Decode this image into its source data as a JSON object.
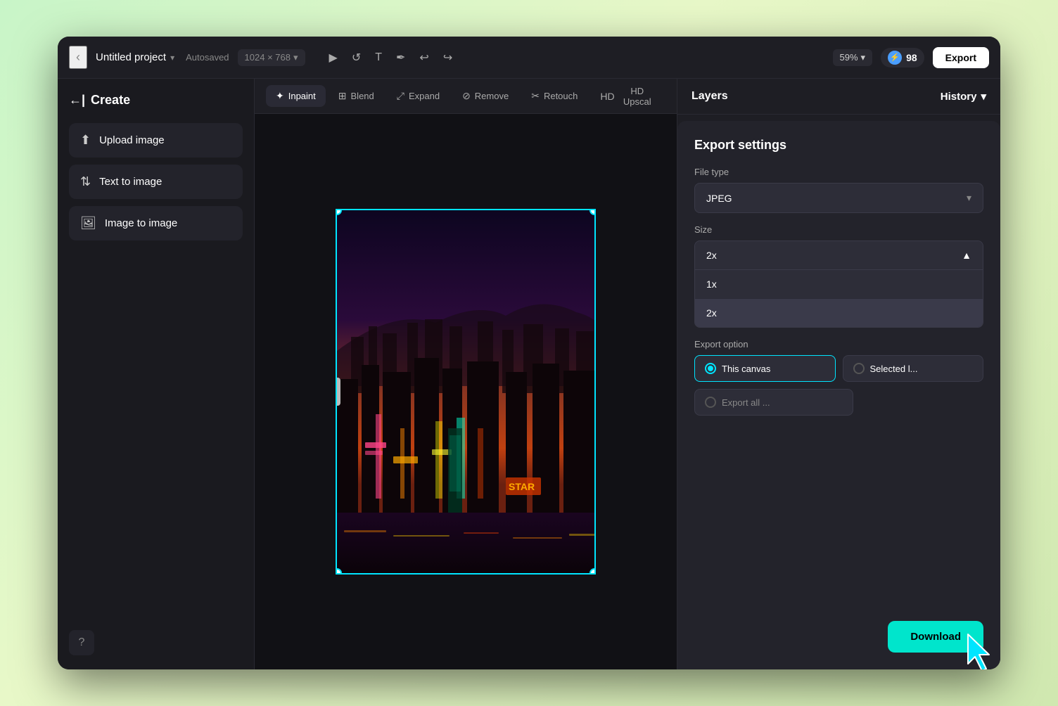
{
  "window": {
    "title": "Untitled project",
    "autosaved": "Autosaved",
    "dimensions": "1024 × 768",
    "zoom": "59%",
    "credits": "98",
    "export_btn": "Export"
  },
  "tools": {
    "select": "▶",
    "rotate": "↺",
    "text": "T",
    "pen": "✒",
    "undo": "↩",
    "redo": "↪"
  },
  "sidebar": {
    "title": "Create",
    "back_icon": "←|",
    "buttons": [
      {
        "label": "Upload image",
        "icon": "⬆"
      },
      {
        "label": "Text to image",
        "icon": "⇅"
      },
      {
        "label": "Image to image",
        "icon": "🖼"
      }
    ],
    "help": "?"
  },
  "toolbar": {
    "tabs": [
      {
        "label": "Inpaint",
        "icon": "✦",
        "active": true
      },
      {
        "label": "Blend",
        "icon": "⊞",
        "active": false
      },
      {
        "label": "Expand",
        "icon": "⤢",
        "active": false
      },
      {
        "label": "Remove",
        "icon": "⊘",
        "active": false
      },
      {
        "label": "Retouch",
        "icon": "✂",
        "active": false
      },
      {
        "label": "HD Upscal",
        "icon": "HD",
        "active": false
      }
    ]
  },
  "right_panel": {
    "layers_title": "Layers",
    "history_btn": "History"
  },
  "export_settings": {
    "title": "Export settings",
    "file_type_label": "File type",
    "file_type_value": "JPEG",
    "size_label": "Size",
    "size_value": "2x",
    "size_options": [
      "1x",
      "2x"
    ],
    "export_option_label": "Export option",
    "this_canvas": "This canvas",
    "selected": "Selected l...",
    "export_all": "Export all ...",
    "download": "Download"
  }
}
